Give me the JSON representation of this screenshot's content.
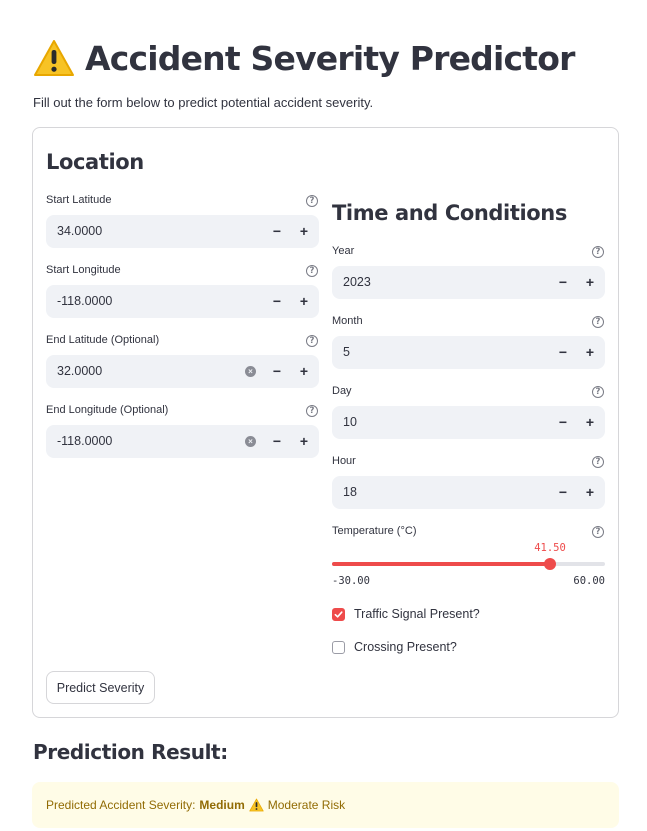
{
  "page": {
    "title": "Accident Severity Predictor",
    "subtitle": "Fill out the form below to predict potential accident severity."
  },
  "location": {
    "heading": "Location",
    "fields": [
      {
        "label": "Start Latitude",
        "value": "34.0000"
      },
      {
        "label": "Start Longitude",
        "value": "-118.0000"
      },
      {
        "label": "End Latitude (Optional)",
        "value": "32.0000"
      },
      {
        "label": "End Longitude (Optional)",
        "value": "-118.0000"
      }
    ]
  },
  "conditions": {
    "heading": "Time and Conditions",
    "fields": [
      {
        "label": "Year",
        "value": "2023"
      },
      {
        "label": "Month",
        "value": "5"
      },
      {
        "label": "Day",
        "value": "10"
      },
      {
        "label": "Hour",
        "value": "18"
      }
    ],
    "temperature": {
      "label": "Temperature (°C)",
      "value": "41.50",
      "min": "-30.00",
      "max": "60.00",
      "fraction": 0.8
    },
    "checkboxes": [
      {
        "label": "Traffic Signal Present?",
        "checked": true
      },
      {
        "label": "Crossing Present?",
        "checked": false
      }
    ]
  },
  "controls": {
    "minus": "−",
    "plus": "+",
    "help": "?",
    "clear": "×"
  },
  "predict_button": "Predict Severity",
  "result": {
    "heading": "Prediction Result:",
    "prefix": "Predicted Accident Severity:",
    "severity": "Medium",
    "risk": "Moderate Risk"
  },
  "colors": {
    "accent": "#ee4b4b",
    "input_bg": "#f0f2f6",
    "warning_bg": "#fffce7",
    "warning_text": "#926c05"
  },
  "icons": [
    "warning-icon",
    "help-icon",
    "clear-icon",
    "check-icon"
  ]
}
